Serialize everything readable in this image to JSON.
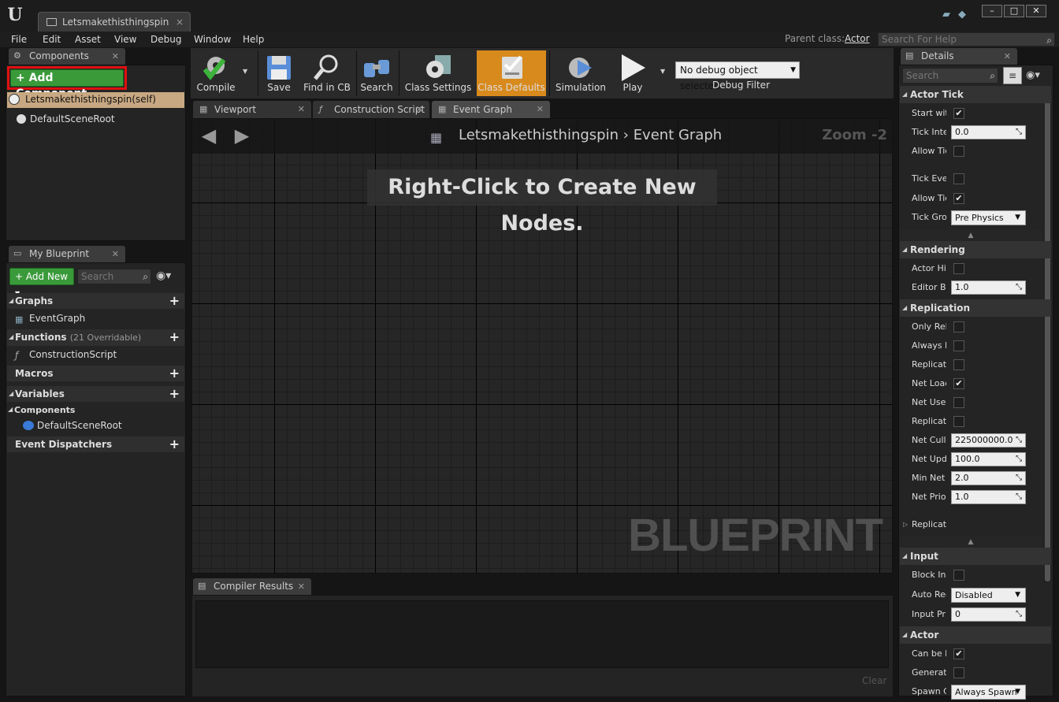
{
  "window": {
    "tab_title": "Letsmakethisthingspin",
    "tab_close": "×",
    "min": "–",
    "max": "□",
    "close": "✕"
  },
  "menu": {
    "items": [
      "File",
      "Edit",
      "Asset",
      "View",
      "Debug",
      "Window",
      "Help"
    ],
    "parent_label": "Parent class:",
    "parent_value": "Actor",
    "help_search_placeholder": "Search For Help"
  },
  "components": {
    "tab": "Components",
    "add_button": "Add Component",
    "items": [
      "Letsmakethisthingspin(self)",
      "DefaultSceneRoot"
    ]
  },
  "my_blueprint": {
    "tab": "My Blueprint",
    "add_new": "Add New",
    "search_placeholder": "Search",
    "graphs": "Graphs",
    "graphs_item": "EventGraph",
    "functions": "Functions",
    "functions_note": "(21 Overridable)",
    "functions_item": "ConstructionScript",
    "macros": "Macros",
    "variables": "Variables",
    "components_cat": "Components",
    "components_item": "DefaultSceneRoot",
    "dispatchers": "Event Dispatchers"
  },
  "toolbar": {
    "compile": "Compile",
    "save": "Save",
    "find_in_cb": "Find in CB",
    "search": "Search",
    "class_settings": "Class Settings",
    "class_defaults": "Class Defaults",
    "simulation": "Simulation",
    "play": "Play",
    "debug_object": "No debug object selected",
    "debug_filter": "Debug Filter"
  },
  "graph_tabs": [
    "Viewport",
    "Construction Script",
    "Event Graph"
  ],
  "graph": {
    "crumb_root": "Letsmakethisthingspin",
    "crumb_sep": "›",
    "crumb_leaf": "Event Graph",
    "zoom": "Zoom -2",
    "hint": "Right-Click to Create New Nodes.",
    "watermark": "BLUEPRINT"
  },
  "compiler": {
    "tab": "Compiler Results",
    "clear": "Clear"
  },
  "details": {
    "tab": "Details",
    "search_placeholder": "Search",
    "actor_tick": "Actor Tick",
    "tick_rows": [
      {
        "label": "Start wit",
        "type": "check",
        "checked": true
      },
      {
        "label": "Tick Inte",
        "type": "field",
        "value": "0.0"
      },
      {
        "label": "Allow Tic",
        "type": "check",
        "checked": false
      }
    ],
    "tick_adv": [
      {
        "label": "Tick Eve",
        "type": "check",
        "checked": false
      },
      {
        "label": "Allow Tic",
        "type": "check",
        "checked": true
      },
      {
        "label": "Tick Grou",
        "type": "dd",
        "value": "Pre Physics"
      }
    ],
    "rendering": "Rendering",
    "render_rows": [
      {
        "label": "Actor Hid",
        "type": "check",
        "checked": false
      },
      {
        "label": "Editor Bil",
        "type": "field",
        "value": "1.0"
      }
    ],
    "replication": "Replication",
    "rep_rows": [
      {
        "label": "Only Rele",
        "type": "check",
        "checked": false
      },
      {
        "label": "Always R",
        "type": "check",
        "checked": false
      },
      {
        "label": "Replicate",
        "type": "check",
        "checked": false
      },
      {
        "label": "Net Load",
        "type": "check",
        "checked": true
      },
      {
        "label": "Net Use",
        "type": "check",
        "checked": false
      },
      {
        "label": "Replicate",
        "type": "check",
        "checked": false
      },
      {
        "label": "Net Cull",
        "type": "field",
        "value": "225000000.0"
      },
      {
        "label": "Net Upda",
        "type": "field",
        "value": "100.0"
      },
      {
        "label": "Min Net",
        "type": "field",
        "value": "2.0"
      },
      {
        "label": "Net Prior",
        "type": "field",
        "value": "1.0"
      }
    ],
    "rep_collapsed": "Replicate",
    "input": "Input",
    "input_rows": [
      {
        "label": "Block Inp",
        "type": "check",
        "checked": false
      },
      {
        "label": "Auto Rec",
        "type": "dd",
        "value": "Disabled"
      },
      {
        "label": "Input Prio",
        "type": "field",
        "value": "0"
      }
    ],
    "actor": "Actor",
    "actor_rows": [
      {
        "label": "Can be D",
        "type": "check",
        "checked": true
      },
      {
        "label": "Generate",
        "type": "check",
        "checked": false
      },
      {
        "label": "Spawn C",
        "type": "dd",
        "value": "Always Spawn"
      }
    ]
  },
  "colors": {
    "highlight_red": "#e01010",
    "accent_green": "#3a9a3a",
    "accent_orange": "#d88a1c",
    "self_item_bg": "#c8a882"
  }
}
